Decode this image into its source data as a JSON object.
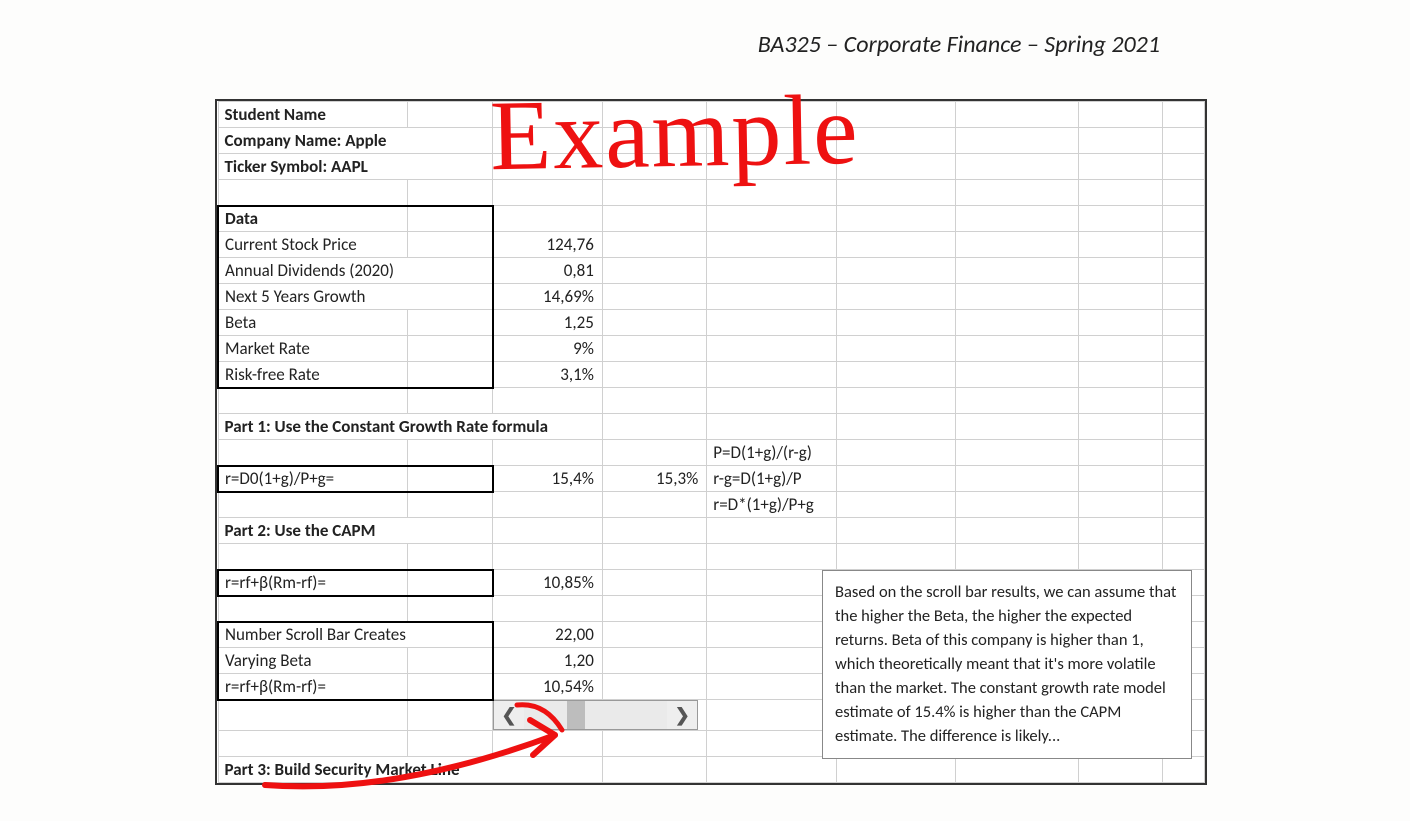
{
  "header": "BA325 – Corporate Finance – Spring 2021",
  "handwriting": "Example",
  "rows": {
    "student_name": "Student Name",
    "company_name": "Company Name: Apple",
    "ticker": "Ticker Symbol: AAPL",
    "data_header": "Data",
    "data": [
      {
        "label": "Current Stock Price",
        "value": "124,76"
      },
      {
        "label": "Annual Dividends (2020)",
        "value": "0,81"
      },
      {
        "label": "Next 5 Years Growth",
        "value": "14,69%"
      },
      {
        "label": "Beta",
        "value": "1,25"
      },
      {
        "label": "Market Rate",
        "value": "9%"
      },
      {
        "label": "Risk-free Rate",
        "value": "3,1%"
      }
    ],
    "part1_header": "Part 1: Use the Constant Growth Rate formula",
    "part1_formula_label": "r=D0(1+g)/P+g=",
    "part1_value": "15,4%",
    "part1_alt_value": "15,3%",
    "side_formulas": {
      "f1": "P=D(1+g)/(r-g)",
      "f2": "r-g=D(1+g)/P",
      "f3": "r=D*(1+g)/P+g"
    },
    "part2_header": "Part 2: Use the CAPM",
    "capm_label": "r=rf+β(Rm-rf)=",
    "capm_value": "10,85%",
    "scroll_label": "Number Scroll Bar Creates",
    "scroll_value": "22,00",
    "varying_beta_label": "Varying Beta",
    "varying_beta_value": "1,20",
    "capm2_label": "r=rf+β(Rm-rf)=",
    "capm2_value": "10,54%",
    "part3_header": "Part 3: Build Security Market Line"
  },
  "note": "Based on the scroll bar results, we can assume that the higher the Beta, the higher the expected returns. Beta of this company is higher than 1, which theoretically meant that it's more volatile than the market. The constant growth rate model estimate of 15.4% is higher than the CAPM estimate. The difference is likely..."
}
